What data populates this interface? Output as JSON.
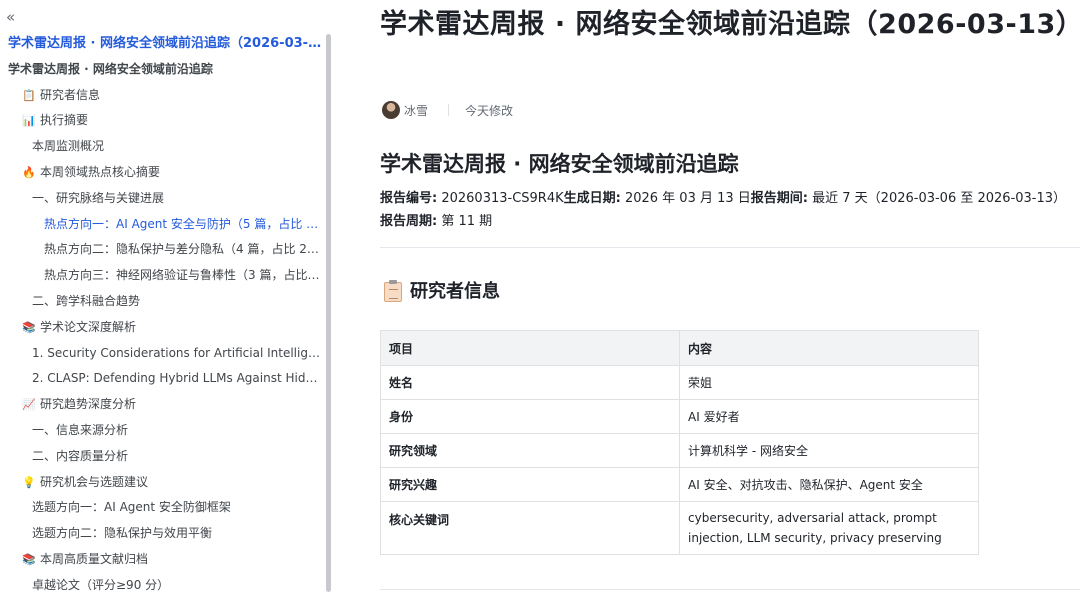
{
  "sidebar": {
    "collapse_glyph": "«",
    "items": [
      {
        "label": "学术雷达周报 · 网络安全领域前沿追踪（2026-03-1...",
        "level": 0,
        "style": "title",
        "icon": ""
      },
      {
        "label": "学术雷达周报 · 网络安全领域前沿追踪",
        "level": 0,
        "style": "doc",
        "icon": ""
      },
      {
        "label": "研究者信息",
        "level": 1,
        "style": "",
        "icon": "📋"
      },
      {
        "label": "执行摘要",
        "level": 1,
        "style": "",
        "icon": "📊"
      },
      {
        "label": "本周监测概况",
        "level": 2,
        "style": "",
        "icon": ""
      },
      {
        "label": "本周领域热点核心摘要",
        "level": 1,
        "style": "",
        "icon": "🔥"
      },
      {
        "label": "一、研究脉络与关键进展",
        "level": 2,
        "style": "",
        "icon": ""
      },
      {
        "label": "热点方向一：AI Agent 安全与防护（5 篇，占比 31...",
        "level": 3,
        "style": "active",
        "icon": ""
      },
      {
        "label": "热点方向二：隐私保护与差分隐私（4 篇，占比 25....",
        "level": 3,
        "style": "",
        "icon": ""
      },
      {
        "label": "热点方向三：神经网络验证与鲁棒性（3 篇，占比 ...",
        "level": 3,
        "style": "",
        "icon": ""
      },
      {
        "label": "二、跨学科融合趋势",
        "level": 2,
        "style": "",
        "icon": ""
      },
      {
        "label": "学术论文深度解析",
        "level": 1,
        "style": "",
        "icon": "📚"
      },
      {
        "label": "1. Security Considerations for Artificial Intelligence A...",
        "level": 2,
        "style": "",
        "icon": ""
      },
      {
        "label": "2. CLASP: Defending Hybrid LLMs Against Hidden Sta...",
        "level": 2,
        "style": "",
        "icon": ""
      },
      {
        "label": "研究趋势深度分析",
        "level": 1,
        "style": "",
        "icon": "📈"
      },
      {
        "label": "一、信息来源分析",
        "level": 2,
        "style": "",
        "icon": ""
      },
      {
        "label": "二、内容质量分析",
        "level": 2,
        "style": "",
        "icon": ""
      },
      {
        "label": "研究机会与选题建议",
        "level": 1,
        "style": "",
        "icon": "💡"
      },
      {
        "label": "选题方向一：AI Agent 安全防御框架",
        "level": 2,
        "style": "",
        "icon": ""
      },
      {
        "label": "选题方向二：隐私保护与效用平衡",
        "level": 2,
        "style": "",
        "icon": ""
      },
      {
        "label": "本周高质量文献归档",
        "level": 1,
        "style": "",
        "icon": "📚"
      },
      {
        "label": "卓越论文（评分≥90 分）",
        "level": 2,
        "style": "",
        "icon": ""
      }
    ]
  },
  "doc": {
    "title": "学术雷达周报 · 网络安全领域前沿追踪（2026-03-13）",
    "author": "冰雪",
    "modified": "今天修改",
    "h1": "学术雷达周报 · 网络安全领域前沿追踪",
    "report_no_label": "报告编号:",
    "report_no": " 20260313-CS9R4K",
    "gen_date_label": "生成日期:",
    "gen_date": " 2026 年 03 月 13 日",
    "period_label": "报告期间:",
    "period": " 最近 7 天（2026-03-06 至 2026-03-13）",
    "week_label": "报告周期:",
    "week": " 第 11 期",
    "h2": "研究者信息",
    "table": {
      "header": [
        "项目",
        "内容"
      ],
      "rows": [
        [
          "姓名",
          "荣姐"
        ],
        [
          "身份",
          "AI 爱好者"
        ],
        [
          "研究领域",
          "计算机科学 - 网络安全"
        ],
        [
          "研究兴趣",
          "AI 安全、对抗攻击、隐私保护、Agent 安全"
        ],
        [
          "核心关键词",
          "cybersecurity, adversarial attack, prompt injection, LLM security, privacy preserving"
        ]
      ]
    }
  }
}
